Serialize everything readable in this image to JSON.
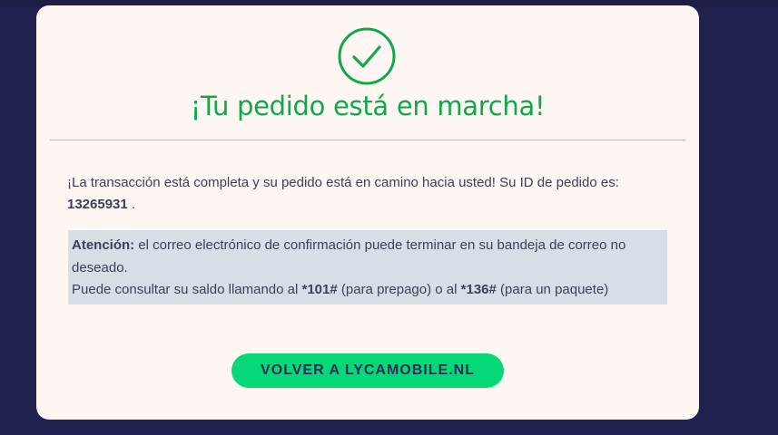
{
  "success": {
    "icon": "check-circle-icon",
    "title": "¡Tu pedido está en marcha!"
  },
  "message": {
    "text": "¡La transacción está completa y su pedido está en camino hacia usted! Su ID de pedido es:",
    "order_id": "13265931",
    "suffix": " ."
  },
  "notice": {
    "label": "Atención:",
    "line1": " el correo electrónico de confirmación puede terminar en su bandeja de correo no deseado.",
    "line2_prefix": "Puede consultar su saldo llamando al ",
    "code_prepaid": "*101#",
    "line2_mid": " (para prepago) o al ",
    "code_package": "*136#",
    "line2_suffix": " (para un paquete)"
  },
  "cta": {
    "label": "VOLVER A LYCAMOBILE.NL"
  },
  "colors": {
    "background": "#212150",
    "card": "#fdf6f3",
    "success_green": "#12a84a",
    "button_green": "#07d877",
    "notice_bg": "#d6dfe6"
  }
}
